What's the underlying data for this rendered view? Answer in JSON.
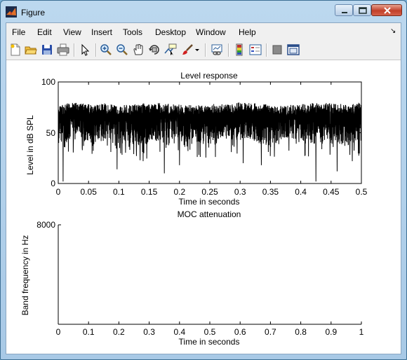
{
  "window": {
    "title": "Figure",
    "icon": "matlab-logo-icon"
  },
  "menu": [
    "File",
    "Edit",
    "View",
    "Insert",
    "Tools",
    "Desktop",
    "Window",
    "Help"
  ],
  "toolbar": [
    "new-figure-icon",
    "open-file-icon",
    "save-icon",
    "print-icon",
    "pointer-icon",
    "zoom-in-icon",
    "zoom-out-icon",
    "pan-hand-icon",
    "rotate-3d-icon",
    "data-cursor-icon",
    "brush-icon",
    "link-plot-icon",
    "colorbar-icon",
    "legend-icon",
    "hide-plot-tools-icon",
    "show-plot-tools-icon"
  ],
  "chart_data": [
    {
      "type": "line",
      "title": "Level response",
      "xlabel": "Time in seconds",
      "ylabel": "Level in dB SPL",
      "xlim": [
        0,
        0.5
      ],
      "ylim": [
        0,
        100
      ],
      "xticks": [
        "0",
        "0.05",
        "0.1",
        "0.15",
        "0.2",
        "0.25",
        "0.3",
        "0.35",
        "0.4",
        "0.45",
        "0.5"
      ],
      "yticks": [
        "0",
        "50",
        "100"
      ],
      "series": [
        {
          "color": "#000000",
          "description_values": {
            "upper_envelope_db": [
              77,
              80,
              78,
              79,
              77,
              78,
              80,
              79,
              78,
              77,
              79,
              78,
              80,
              79,
              78,
              77,
              78,
              80,
              79,
              78,
              80
            ],
            "typical_lower_db": [
              38,
              45,
              40,
              42,
              44,
              36,
              40,
              43,
              45,
              41,
              38,
              44,
              42,
              40,
              37,
              45,
              41,
              39,
              43,
              36,
              40
            ],
            "deep_dips": [
              {
                "x": 0.008,
                "y": 2
              },
              {
                "x": 0.097,
                "y": 14
              },
              {
                "x": 0.14,
                "y": 22
              },
              {
                "x": 0.175,
                "y": 10
              },
              {
                "x": 0.2,
                "y": 18
              },
              {
                "x": 0.305,
                "y": 20
              },
              {
                "x": 0.335,
                "y": 18
              },
              {
                "x": 0.425,
                "y": 2
              },
              {
                "x": 0.46,
                "y": 12
              },
              {
                "x": 0.485,
                "y": 22
              }
            ]
          }
        }
      ]
    },
    {
      "type": "line",
      "title": "MOC attenuation",
      "xlabel": "Time in seconds",
      "ylabel": "Band frequency in Hz",
      "xlim": [
        0,
        1
      ],
      "xticks": [
        "0",
        "0.1",
        "0.2",
        "0.3",
        "0.4",
        "0.5",
        "0.6",
        "0.7",
        "0.8",
        "0.9",
        "1"
      ],
      "yticks": [
        "8000"
      ],
      "series": []
    }
  ]
}
